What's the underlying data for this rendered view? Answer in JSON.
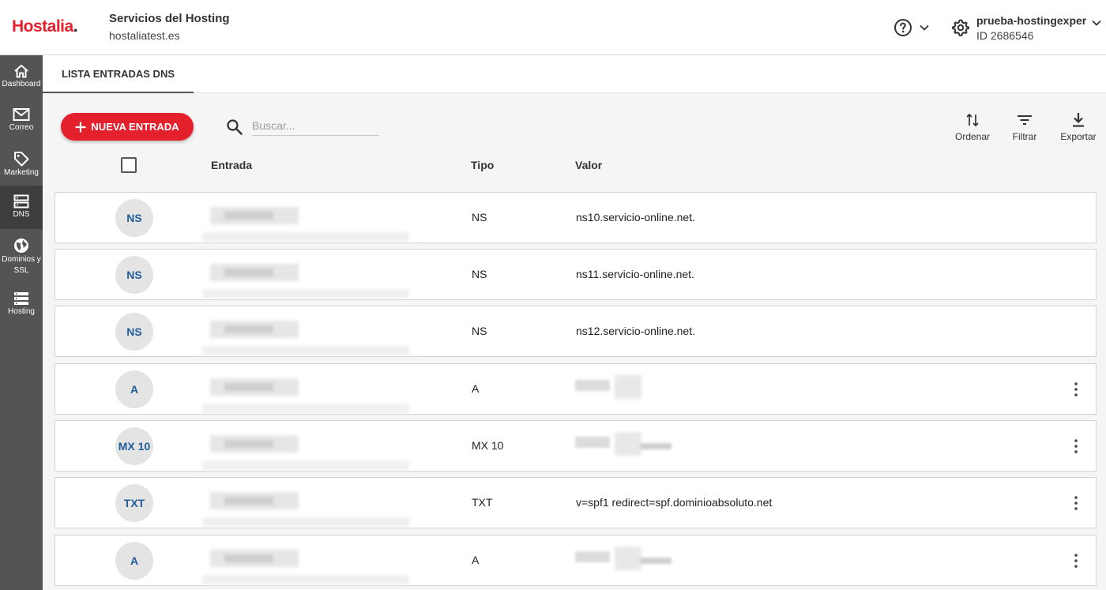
{
  "brand": {
    "logo_text": "Hostalia",
    "logo_dot": ".",
    "accent": "#e4202c"
  },
  "header": {
    "service_title": "Servicios del Hosting",
    "domain": "hostaliatest.es",
    "account_name": "prueba-hostingexper",
    "account_id": "ID 2686546",
    "icons": [
      "help-circle-icon",
      "chevron-down-icon",
      "gear-icon"
    ]
  },
  "sidebar": {
    "items": [
      {
        "label": "Dashboard",
        "icon": "home-icon",
        "active": false
      },
      {
        "label": "Correo",
        "icon": "mail-icon",
        "active": false
      },
      {
        "label": "Marketing",
        "icon": "tag-icon",
        "active": false
      },
      {
        "label": "DNS",
        "icon": "server-icon",
        "active": true
      },
      {
        "label": "Dominios y SSL",
        "icon": "globe-icon",
        "active": false
      },
      {
        "label": "Hosting",
        "icon": "hosting-icon",
        "active": false
      }
    ]
  },
  "tabs": [
    {
      "label": "LISTA ENTRADAS DNS",
      "active": true
    }
  ],
  "toolbar": {
    "new_entry_label": "NUEVA ENTRADA",
    "search_placeholder": "Buscar...",
    "sort_label": "Ordenar",
    "filter_label": "Filtrar",
    "export_label": "Exportar"
  },
  "table": {
    "columns": [
      "Entrada",
      "Tipo",
      "Valor"
    ],
    "rows": [
      {
        "badge": "NS",
        "tipo": "NS",
        "valor": "ns10.servicio-online.net.",
        "has_menu": false
      },
      {
        "badge": "NS",
        "tipo": "NS",
        "valor": "ns11.servicio-online.net.",
        "has_menu": false
      },
      {
        "badge": "NS",
        "tipo": "NS",
        "valor": "ns12.servicio-online.net.",
        "has_menu": false
      },
      {
        "badge": "A",
        "tipo": "A",
        "valor": "",
        "has_menu": true
      },
      {
        "badge": "MX 10",
        "tipo": "MX 10",
        "valor": "",
        "has_menu": true
      },
      {
        "badge": "TXT",
        "tipo": "TXT",
        "valor": "v=spf1 redirect=spf.dominioabsoluto.net",
        "has_menu": true
      },
      {
        "badge": "A",
        "tipo": "A",
        "valor": "",
        "has_menu": true
      }
    ]
  }
}
